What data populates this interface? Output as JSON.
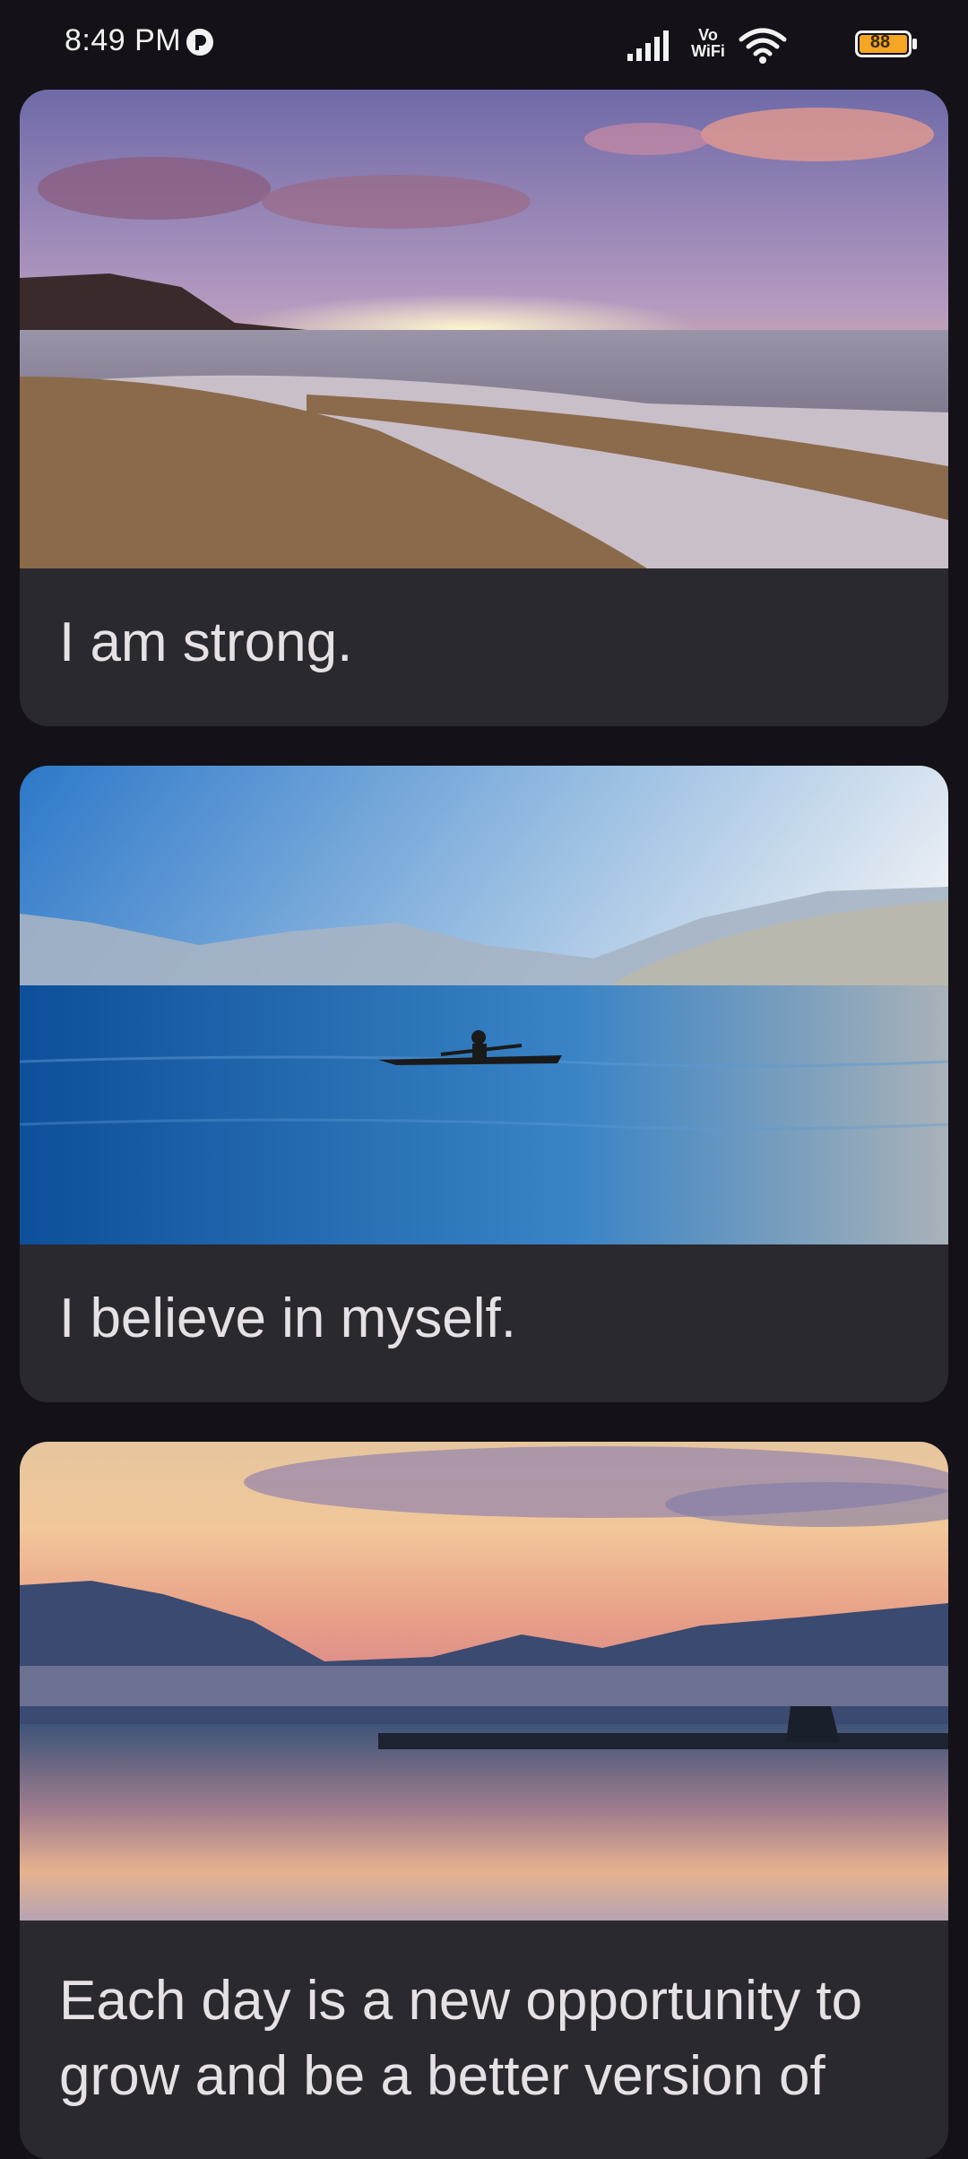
{
  "status_bar": {
    "time": "8:49 PM",
    "network_label": "Vo\nWiFi",
    "battery_level": "88",
    "colors": {
      "battery": "#f5a623"
    },
    "icons": [
      "app-notification-icon",
      "signal-icon",
      "vowifi-icon",
      "wifi-icon",
      "battery-icon"
    ]
  },
  "cards": [
    {
      "text": "I am strong.",
      "image": "beach-sunset-image"
    },
    {
      "text": "I believe in myself.",
      "image": "lake-kayak-image"
    },
    {
      "text": "Each day is a new opportunity to grow and be a better version of",
      "image": "lake-dock-sunset-image"
    }
  ],
  "colors": {
    "background": "#141218",
    "card": "#2b2930",
    "text": "#e6e1e5"
  }
}
